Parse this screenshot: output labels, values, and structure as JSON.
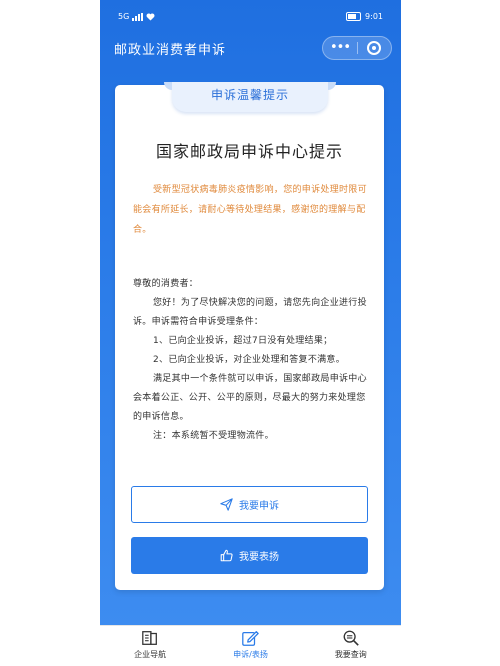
{
  "status_bar": {
    "left_text": "5G",
    "right_text": "9:01"
  },
  "nav": {
    "title": "邮政业消费者申诉",
    "more_label": "•••"
  },
  "card": {
    "ribbon": "申诉温馨提示",
    "title": "国家邮政局申诉中心提示",
    "notice": "受新型冠状病毒肺炎疫情影响，您的申诉处理时限可能会有所延长，请耐心等待处理结果，感谢您的理解与配合。",
    "greeting": "尊敬的消费者：",
    "intro": "您好！为了尽快解决您的问题，请您先向企业进行投诉。申诉需符合申诉受理条件：",
    "cond1": "1、已向企业投诉，超过7日没有处理结果；",
    "cond2": "2、已向企业投诉，对企业处理和答复不满意。",
    "closing": "满足其中一个条件就可以申诉，国家邮政局申诉中心会本着公正、公开、公平的原则，尽最大的努力来处理您的申诉信息。",
    "note": "注：本系统暂不受理物流件。"
  },
  "buttons": {
    "complain": "我要申诉",
    "praise": "我要表扬"
  },
  "tabs": [
    {
      "label": "企业导航",
      "icon": "book-icon"
    },
    {
      "label": "申诉/表扬",
      "icon": "edit-icon"
    },
    {
      "label": "我要查询",
      "icon": "search-icon"
    }
  ],
  "colors": {
    "primary": "#2a7be8",
    "notice": "#e08a3c"
  }
}
